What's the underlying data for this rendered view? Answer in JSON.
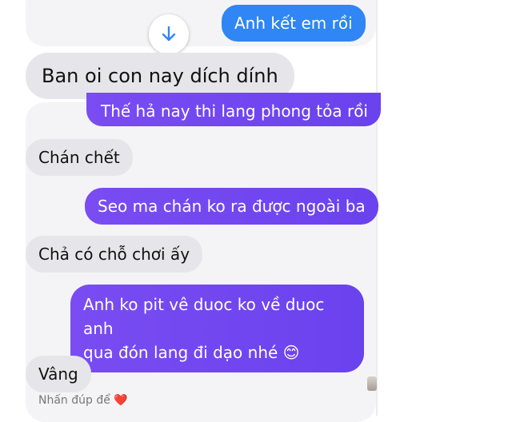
{
  "messages": [
    {
      "text": "Anh kết em rồi"
    },
    {
      "text": "Ban oi con nay dích dính"
    },
    {
      "text": "Thế hả nay thi lang phong tỏa rồi"
    },
    {
      "text": "Chán chết"
    },
    {
      "text": "Seo ma chán ko ra được ngoài ba"
    },
    {
      "text": "Chả có chỗ chơi ấy"
    },
    {
      "text": "Anh ko pit vê duoc ko về duoc anh",
      "text2": "qua đón lang đi dạo nhé 😊"
    },
    {
      "text": "Vâng"
    }
  ],
  "hint": {
    "text": "Nhấn đúp để",
    "heart": "❤️"
  },
  "icons": {
    "scroll": "arrow-down-icon",
    "heart": "heart-icon"
  },
  "colors": {
    "blue": "#2f86f4",
    "purple": "#6a42ee",
    "incoming": "#e6e6ea"
  }
}
